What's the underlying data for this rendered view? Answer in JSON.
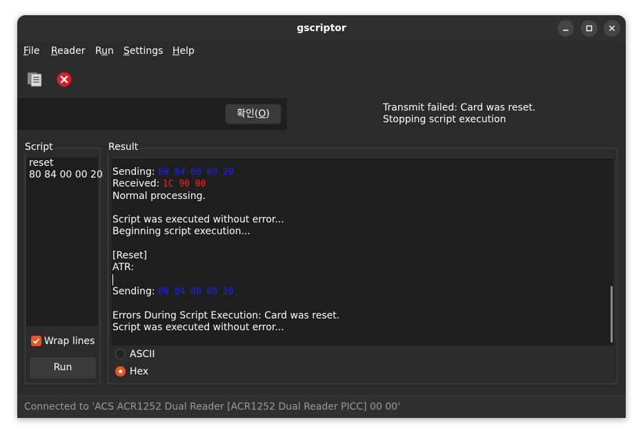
{
  "window": {
    "title": "gscriptor",
    "controls": [
      "minimize",
      "maximize",
      "close"
    ]
  },
  "menubar": {
    "items": [
      {
        "pre": "",
        "mnemonic": "F",
        "post": "ile"
      },
      {
        "pre": "",
        "mnemonic": "R",
        "post": "eader"
      },
      {
        "pre": "R",
        "mnemonic": "u",
        "post": "n"
      },
      {
        "pre": "",
        "mnemonic": "S",
        "post": "ettings"
      },
      {
        "pre": "",
        "mnemonic": "H",
        "post": "elp"
      }
    ]
  },
  "toolbar": {
    "icons": [
      "document-list-icon",
      "error-stop-icon"
    ]
  },
  "infobar": {
    "confirm_pre": "확인(",
    "confirm_mnemonic": "O",
    "confirm_post": ")",
    "message_line1": "Transmit failed: Card was reset.",
    "message_line2": "Stopping script execution"
  },
  "script_panel": {
    "label": "Script",
    "lines": [
      "reset",
      "80 84 00 00 20"
    ],
    "wrap_label": "Wrap lines",
    "wrap_checked": true,
    "run_label": "Run"
  },
  "result_panel": {
    "label": "Result",
    "lines": {
      "sending1_label": "Sending: ",
      "sending1_value": "80 84 00 00 20",
      "received_label": "Received: ",
      "received_value": "1C 90 00",
      "normal": "Normal processing.",
      "executed1": "Script was executed without error...",
      "beginning": "Beginning script execution...",
      "reset": "[Reset]",
      "atr": "ATR:",
      "sending2_label": "Sending: ",
      "sending2_value": "80 84 00 00 20",
      "errors": "Errors During Script Execution: Card was reset.",
      "executed2": "Script was executed without error..."
    },
    "modes": [
      {
        "label": "ASCII",
        "selected": false
      },
      {
        "label": "Hex",
        "selected": true
      }
    ]
  },
  "status": {
    "text": "Connected to 'ACS ACR1252 Dual Reader [ACR1252 Dual Reader PICC] 00 00'"
  },
  "colors": {
    "accent": "#e95420",
    "hex_blue": "#1e1eff",
    "hex_red": "#ff1e1e",
    "window_bg": "#2b2b2b",
    "text_area_bg": "#1e1e1e"
  }
}
